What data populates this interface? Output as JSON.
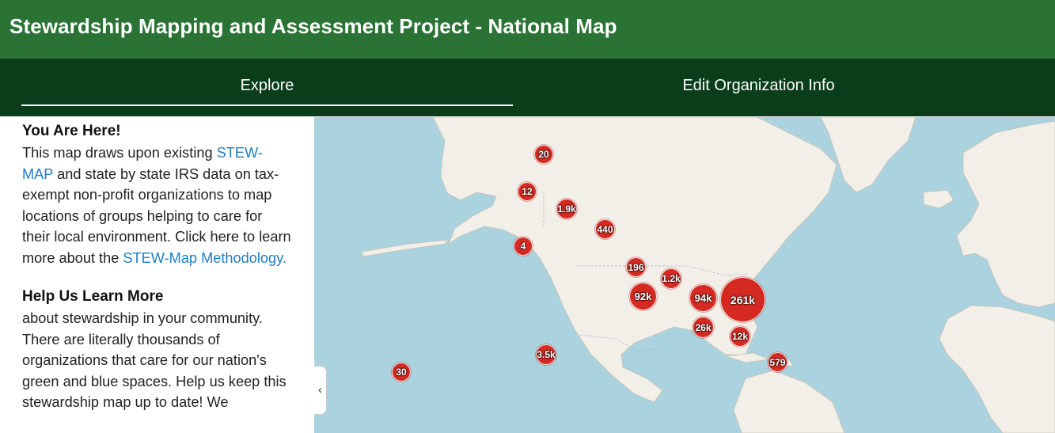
{
  "app": {
    "title": "Stewardship Mapping and Assessment Project - National Map"
  },
  "tabs": [
    {
      "label": "Explore",
      "active": true
    },
    {
      "label": "Edit Organization Info",
      "active": false
    }
  ],
  "panel": {
    "section1": {
      "heading": "You Are Here!",
      "text_a": "This map draws upon existing ",
      "link_a": "STEW-MAP",
      "text_b": " and state by state IRS data on tax-exempt non-profit organizations to map locations of groups helping to care for their local environment. Click here to learn more about the ",
      "link_b": "STEW-Map Methodology."
    },
    "section2": {
      "heading": "Help Us Learn More",
      "text": "about stewardship in your community. There are literally thousands of organizations that care for our nation's green and blue spaces. Help us keep this stewardship map up to date! We"
    },
    "collapse_icon": "chevron-left-icon"
  },
  "map": {
    "water_color": "#aad3df",
    "land_color": "#f2efe9",
    "cluster_color": "#d42a22",
    "clusters": [
      {
        "label": "20"
      },
      {
        "label": "12"
      },
      {
        "label": "1.9k"
      },
      {
        "label": "440"
      },
      {
        "label": "4"
      },
      {
        "label": "196"
      },
      {
        "label": "1.2k"
      },
      {
        "label": "92k"
      },
      {
        "label": "94k"
      },
      {
        "label": "261k"
      },
      {
        "label": "26k"
      },
      {
        "label": "12k"
      },
      {
        "label": "579"
      },
      {
        "label": "3.5k"
      },
      {
        "label": "30"
      }
    ]
  }
}
